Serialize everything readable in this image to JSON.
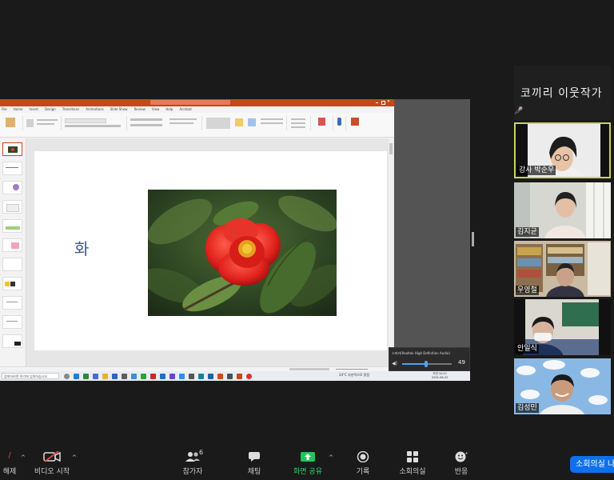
{
  "powerpoint": {
    "tabs": [
      "File",
      "Home",
      "Insert",
      "Design",
      "Transitions",
      "Animations",
      "Slide Show",
      "Review",
      "View",
      "Help",
      "Acrobat"
    ],
    "slide_text": "화",
    "taskbar_search": "검색하려면 여기에 입력하십시오.",
    "weather": "24°C 부분적으로 맑음",
    "clock_time": "오전 10:11",
    "clock_date": "2021-06-22"
  },
  "volume": {
    "device": "스피커(Realtek High Definition Audio)",
    "level": 49,
    "level_text": "49"
  },
  "panel": {
    "meeting_name": "코끼리 이웃작가",
    "participants": [
      {
        "name": "강사 박순우",
        "active": true
      },
      {
        "name": "김지균",
        "active": false
      },
      {
        "name": "우영철",
        "active": false
      },
      {
        "name": "안일식",
        "active": false
      },
      {
        "name": "김성민",
        "active": false
      }
    ]
  },
  "toolbar": {
    "unmute_label": "해제",
    "video_label": "비디오 시작",
    "participants_label": "참가자",
    "participants_count": "6",
    "chat_label": "채팅",
    "share_label": "화면 공유",
    "record_label": "기록",
    "breakout_label": "소회의실",
    "reactions_label": "반응",
    "breakout_button": "소회의실 나"
  },
  "colors": {
    "ppt_accent": "#c5471c",
    "share_green": "#22c35b",
    "end_blue": "#0e71eb",
    "active_border": "#c7d55e"
  }
}
